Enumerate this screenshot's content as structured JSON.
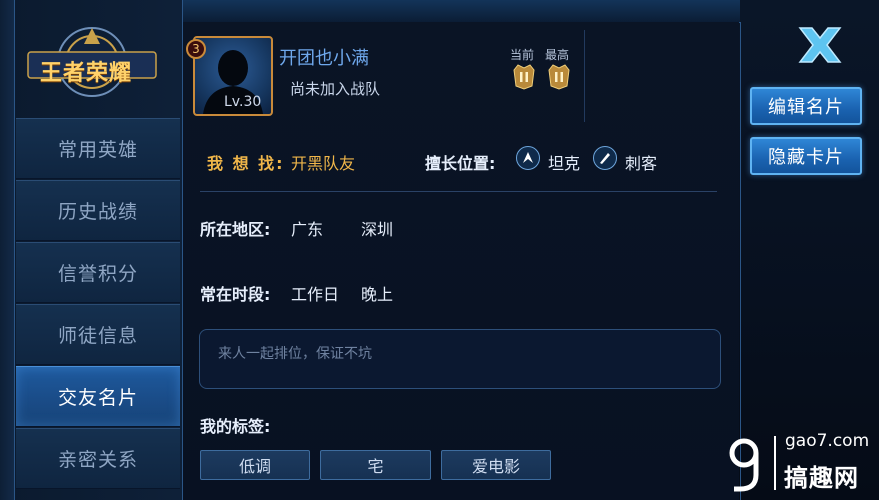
{
  "logo": {
    "text": "王者荣耀"
  },
  "sidebar": {
    "items": [
      {
        "label": "常用英雄"
      },
      {
        "label": "历史战绩"
      },
      {
        "label": "信誉积分"
      },
      {
        "label": "师徒信息"
      },
      {
        "label": "交友名片"
      },
      {
        "label": "亲密关系"
      }
    ],
    "active": "交友名片"
  },
  "profile": {
    "badge": "3",
    "level": "Lv.30",
    "name": "开团也小满",
    "team_status": "尚未加入战队",
    "rank_current_label": "当前",
    "rank_best_label": "最高"
  },
  "actions": {
    "edit_label": "编辑名片",
    "hide_label": "隐藏卡片"
  },
  "card": {
    "want_label": "我 想 找:",
    "want_value": "开黑队友",
    "position_label": "擅长位置:",
    "positions": [
      {
        "label": "坦克",
        "icon": "tank-role-icon"
      },
      {
        "label": "刺客",
        "icon": "assassin-role-icon"
      }
    ],
    "region_label": "所在地区:",
    "region_province": "广东",
    "region_city": "深圳",
    "time_label": "常在时段:",
    "time_day": "工作日",
    "time_period": "晚上",
    "message_placeholder": "来人一起排位，保证不坑",
    "tags_label": "我的标签:",
    "tags": [
      "低调",
      "宅",
      "爱电影"
    ]
  },
  "watermark": {
    "url": "gao7.com",
    "name": "搞趣网"
  },
  "colors": {
    "accent": "#1e5a9e",
    "highlight": "#f0b64a",
    "name": "#6fa8ec"
  }
}
